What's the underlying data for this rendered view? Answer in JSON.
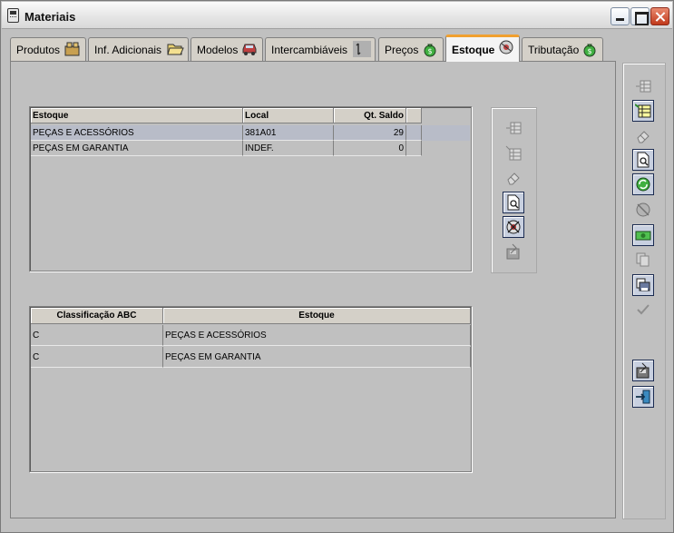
{
  "window": {
    "title": "Materiais"
  },
  "tabs": [
    {
      "label": "Produtos",
      "icon": "box-icon",
      "active": false
    },
    {
      "label": "Inf. Adicionais",
      "icon": "folder-open-icon",
      "active": false
    },
    {
      "label": "Modelos",
      "icon": "car-icon",
      "active": false
    },
    {
      "label": "Intercambiáveis",
      "icon": "exchange-icon",
      "active": false
    },
    {
      "label": "Preços",
      "icon": "money-bag-icon",
      "active": false
    },
    {
      "label": "Estoque",
      "icon": "stock-icon",
      "active": true
    },
    {
      "label": "Tributação",
      "icon": "tax-bag-icon",
      "active": false
    }
  ],
  "stock_grid": {
    "columns": [
      "Estoque",
      "Local",
      "Qt. Saldo"
    ],
    "rows": [
      {
        "estoque": "PEÇAS E ACESSÓRIOS",
        "local": "381A01",
        "saldo": "29"
      },
      {
        "estoque": "PEÇAS EM GARANTIA",
        "local": "INDEF.",
        "saldo": "0"
      }
    ]
  },
  "abc_grid": {
    "columns": [
      "Classificação ABC",
      "Estoque"
    ],
    "rows": [
      {
        "classe": "C",
        "estoque": "PEÇAS E ACESSÓRIOS"
      },
      {
        "classe": "C",
        "estoque": "PEÇAS EM GARANTIA"
      }
    ]
  },
  "inner_toolbar": [
    "insert-row-icon",
    "add-record-icon",
    "eraser-icon",
    "search-doc-icon",
    "cancel-icon",
    "save-icon"
  ],
  "side_toolbar": [
    "insert-row-icon",
    "new-record-icon",
    "eraser-icon",
    "search-doc-icon",
    "refresh-icon",
    "cancel-refresh-icon",
    "money-icon",
    "copy-icon",
    "print-icon",
    "check-icon",
    "save-icon",
    "exit-icon"
  ],
  "colors": {
    "accent_tab": "#f0a030",
    "selection": "#b8bcc8",
    "panel": "#c0c0c0"
  }
}
